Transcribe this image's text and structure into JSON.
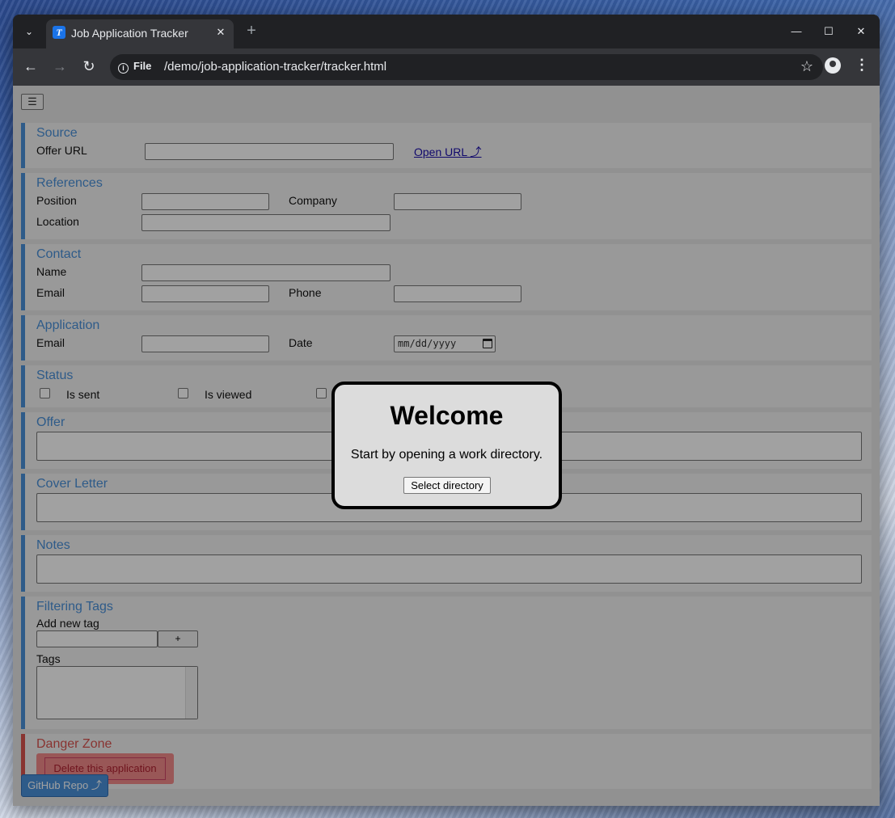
{
  "browser": {
    "tab_title": "Job Application Tracker",
    "tab_favicon": "T",
    "url_scheme_label": "File",
    "url": "/demo/job-application-tracker/tracker.html"
  },
  "app": {
    "menu_toggle": "☰",
    "sections": {
      "source": {
        "title": "Source",
        "offer_url_label": "Offer URL",
        "open_url_link": "Open URL ⤴"
      },
      "references": {
        "title": "References",
        "position_label": "Position",
        "company_label": "Company",
        "location_label": "Location"
      },
      "contact": {
        "title": "Contact",
        "name_label": "Name",
        "email_label": "Email",
        "phone_label": "Phone"
      },
      "application": {
        "title": "Application",
        "email_label": "Email",
        "date_label": "Date",
        "date_placeholder": "mm/dd/yyyy"
      },
      "status": {
        "title": "Status",
        "is_sent_label": "Is sent",
        "is_viewed_label": "Is viewed"
      },
      "offer": {
        "title": "Offer"
      },
      "cover_letter": {
        "title": "Cover Letter"
      },
      "notes": {
        "title": "Notes"
      },
      "filtering_tags": {
        "title": "Filtering Tags",
        "add_new_tag_label": "Add new tag",
        "add_button": "+",
        "tags_label": "Tags"
      },
      "danger_zone": {
        "title": "Danger Zone",
        "delete_button": "Delete this application"
      }
    },
    "github_button": "GitHub Repo ⤴"
  },
  "modal": {
    "title": "Welcome",
    "message": "Start by opening a work directory.",
    "button": "Select directory"
  },
  "colors": {
    "accent": "#4a90d9",
    "danger": "#d9534f"
  }
}
